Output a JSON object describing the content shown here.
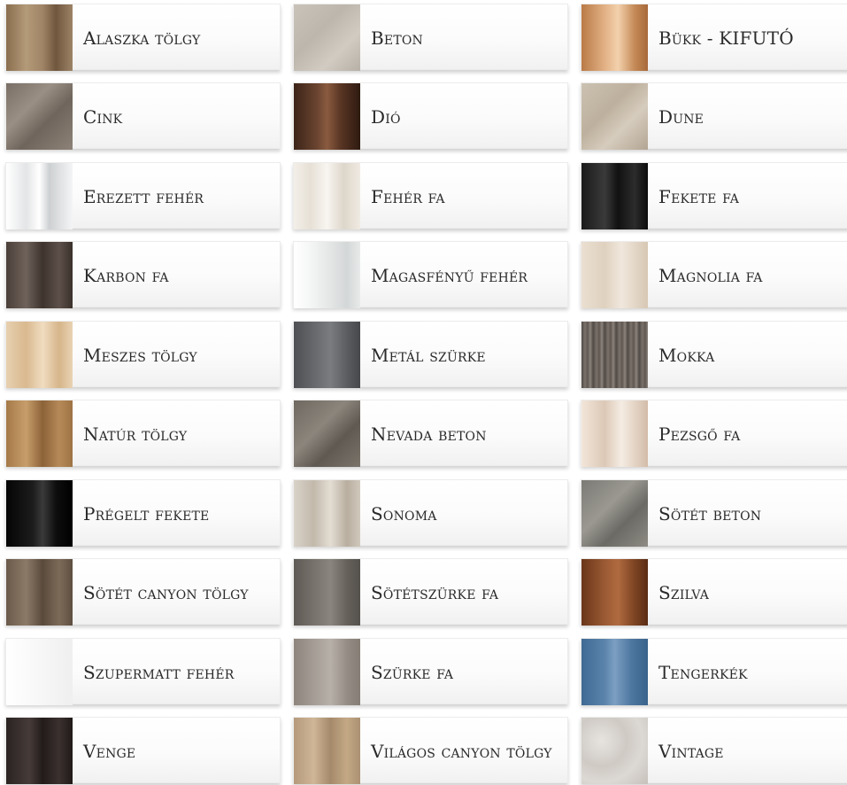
{
  "colors": [
    {
      "name": "Alaszka tölgy",
      "swatch": "linear-gradient(90deg,#8a6e4f 0%,#b39a78 30%,#a08466 55%,#6f563d 75%,#9d8468 100%)"
    },
    {
      "name": "Beton",
      "swatch": "linear-gradient(135deg,#c9c3ba 0%,#bdb6ac 40%,#d1cbc2 70%,#b7b0a6 100%)"
    },
    {
      "name": "Bükk - KIFUTÓ",
      "swatch": "linear-gradient(90deg,#b97a46 0%,#e2b185 35%,#f3d1ad 55%,#c48a57 80%,#a8693a 100%)"
    },
    {
      "name": "Cink",
      "swatch": "linear-gradient(135deg,#7a6f66 0%,#9a8f84 35%,#6f655c 60%,#8d8277 100%)"
    },
    {
      "name": "Dió",
      "swatch": "linear-gradient(90deg,#3c2418 0%,#6a4430 35%,#8a5b40 50%,#5a3624 70%,#2e1a10 100%)"
    },
    {
      "name": "Dune",
      "swatch": "linear-gradient(135deg,#ccc2b2 0%,#bdb09d 40%,#d6ccbd 65%,#b3a593 100%)"
    },
    {
      "name": "Erezett fehér",
      "swatch": "linear-gradient(90deg,#ffffff 0%,#e3e5e6 30%,#ffffff 50%,#cdd0d2 65%,#f4f5f6 100%)"
    },
    {
      "name": "Fehér fa",
      "swatch": "linear-gradient(90deg,#f3efe8 0%,#e6e0d6 25%,#f8f5f0 50%,#ddd6ca 75%,#efeae2 100%)"
    },
    {
      "name": "Fekete fa",
      "swatch": "linear-gradient(90deg,#1a1a1a 0%,#3a3a3a 35%,#111111 55%,#2c2c2c 80%,#0c0c0c 100%)"
    },
    {
      "name": "Karbon fa",
      "swatch": "linear-gradient(90deg,#4b3f39 0%,#6e625b 30%,#3e332d 55%,#5d504a 80%,#3a302b 100%)"
    },
    {
      "name": "Magasfényű fehér",
      "swatch": "linear-gradient(90deg,#ffffff 0%,#f7f8f8 20%,#e4e6e6 55%,#d4d7d7 80%,#e8eaea 100%)"
    },
    {
      "name": "Magnolia fa",
      "swatch": "linear-gradient(90deg,#eadfd1 0%,#dfd1bf 35%,#f0e7dc 60%,#d7c7b3 100%)"
    },
    {
      "name": "Meszes tölgy",
      "swatch": "linear-gradient(90deg,#e7d0b0 0%,#d9b98f 30%,#f0dcc0 55%,#d6b58a 80%,#e9d3b4 100%)"
    },
    {
      "name": "Metál szürke",
      "swatch": "linear-gradient(90deg,#4d4f52 0%,#6a6c70 35%,#7a7c80 55%,#5b5d61 80%,#45474a 100%)"
    },
    {
      "name": "Mokka",
      "swatch": "repeating-linear-gradient(90deg,#4f4843 0px,#7a726b 4px,#5e5650 7px,#8b837c 10px,#534c47 13px)"
    },
    {
      "name": "Natúr tölgy",
      "swatch": "linear-gradient(90deg,#a57a48 0%,#c79e6b 30%,#8c6238 55%,#b68a58 80%,#9e7344 100%)"
    },
    {
      "name": "Nevada beton",
      "swatch": "linear-gradient(135deg,#6e6860 0%,#8b857c 40%,#5f5952 65%,#7a746b 100%)"
    },
    {
      "name": "Pezsgő fa",
      "swatch": "linear-gradient(90deg,#f2e6da 0%,#dcc8b6 35%,#f5ece3 60%,#d3bca8 100%)"
    },
    {
      "name": "Prégelt fekete",
      "swatch": "linear-gradient(90deg,#050505 0%,#1c1c1c 40%,#3a3a3a 55%,#0e0e0e 75%,#000000 100%)"
    },
    {
      "name": "Sonoma",
      "swatch": "linear-gradient(90deg,#d8d2c8 0%,#c2b9ab 30%,#e3ddd3 55%,#b9ae9f 80%,#d0c8bc 100%)"
    },
    {
      "name": "Sötét beton",
      "swatch": "linear-gradient(135deg,#7b7a74 0%,#9a9891 40%,#6b6a64 65%,#8d8b84 100%)"
    },
    {
      "name": "Sötét canyon tölgy",
      "swatch": "linear-gradient(90deg,#6b5a4a 0%,#8c7a68 30%,#5a4a3c 55%,#7d6b59 80%,#5e4e40 100%)"
    },
    {
      "name": "Sötétszürke fa",
      "swatch": "linear-gradient(90deg,#5e5954 0%,#7b7670 35%,#8a857f 55%,#66615b 80%,#54504b 100%)"
    },
    {
      "name": "Szilva",
      "swatch": "linear-gradient(90deg,#6a3519 0%,#9b5a34 35%,#b06a3f 55%,#7d4423 80%,#5a2c14 100%)"
    },
    {
      "name": "Szupermatt fehér",
      "swatch": "linear-gradient(90deg,#ffffff 0%,#f8f8f8 45%,#efefef 100%)"
    },
    {
      "name": "Szürke fa",
      "swatch": "linear-gradient(90deg,#8d857d 0%,#a8a099 35%,#b7b0a9 55%,#958d85 80%,#857d75 100%)"
    },
    {
      "name": "Tengerkék",
      "swatch": "linear-gradient(90deg,#3f6a93 0%,#5b84ab 35%,#7c9fc2 50%,#4e77a0 75%,#3a638b 100%)"
    },
    {
      "name": "Venge",
      "swatch": "linear-gradient(90deg,#2a2322 0%,#463b38 35%,#221b1a 55%,#3b312f 80%,#1f1918 100%)"
    },
    {
      "name": "Világos canyon tölgy",
      "swatch": "linear-gradient(90deg,#b59a7c 0%,#cfb697 30%,#a58a6b 55%,#c4a985 80%,#ab9072 100%)"
    },
    {
      "name": "Vintage",
      "swatch": "radial-gradient(circle at 30% 35%,#e7e4e0 0%,#cfcac4 40%,#dcd8d3 65%,#c6c1bb 100%)"
    }
  ]
}
